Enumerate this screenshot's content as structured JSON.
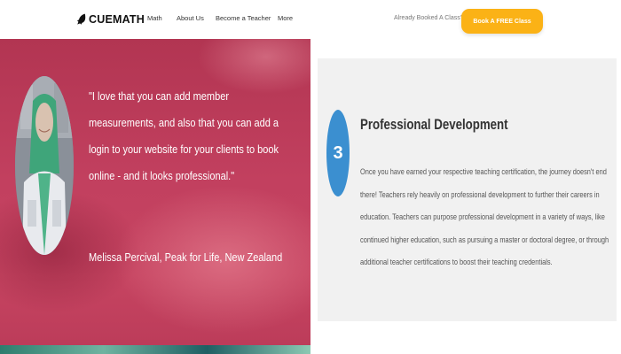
{
  "header": {
    "logo_text": "CUEMATH",
    "logo_icon": "rocket-icon",
    "nav": [
      {
        "label": "Math"
      },
      {
        "label": "About Us"
      },
      {
        "label": "Become a Teacher"
      },
      {
        "label": "More"
      }
    ],
    "booked_link": "Already Booked A Class?",
    "cta_label": "Book A FREE Class"
  },
  "testimonial": {
    "quote": "\"I love that you can add member measurements, and also that you can add a login to your website for your clients to book online - and it looks professional.\"",
    "author": "Melissa Percival, Peak for Life, New Zealand"
  },
  "development": {
    "step_number": "3",
    "title": "Professional Development",
    "body": "Once you have earned your respective teaching certification, the journey doesn't end there! Teachers rely heavily on professional development to further their careers in education. Teachers can purpose professional development in a variety of ways, like continued higher education, such as pursuing a master or doctoral degree, or through additional teacher certifications to boost their teaching credentials."
  },
  "colors": {
    "cta": "#fbb216",
    "testimonial_bg": "#c2405f",
    "step_badge": "#3b8fd0",
    "card_bg": "#f1f1f1"
  }
}
